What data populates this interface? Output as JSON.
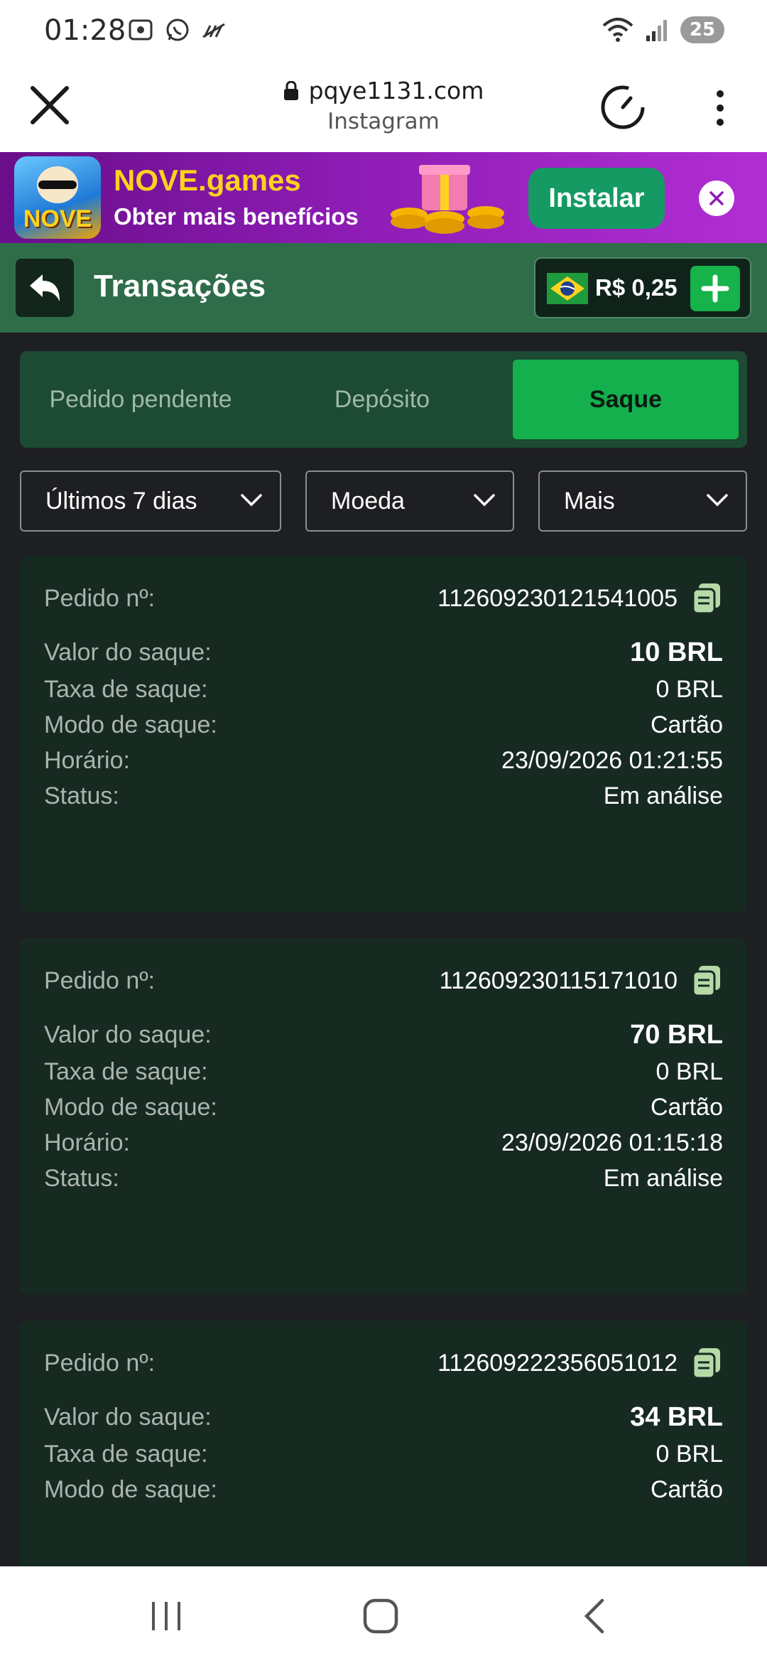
{
  "status_bar": {
    "time": "01:28",
    "battery": "25"
  },
  "browser": {
    "url": "pqye1131.com",
    "source": "Instagram"
  },
  "promo": {
    "brand": "NOVE.games",
    "subtitle": "Obter mais benefícios",
    "install_label": "Instalar",
    "logo_text": "NOVE"
  },
  "header": {
    "title": "Transações",
    "balance": "R$ 0,25"
  },
  "tabs": [
    {
      "label": "Pedido pendente",
      "active": false
    },
    {
      "label": "Depósito",
      "active": false
    },
    {
      "label": "Saque",
      "active": true
    }
  ],
  "filters": {
    "period": "Últimos 7 dias",
    "currency": "Moeda",
    "more": "Mais"
  },
  "labels": {
    "order": "Pedido nº:",
    "amount": "Valor do saque:",
    "fee": "Taxa de saque:",
    "mode": "Modo de saque:",
    "time": "Horário:",
    "status": "Status:"
  },
  "transactions": [
    {
      "order": "112609230121541005",
      "amount": "10 BRL",
      "fee": "0 BRL",
      "mode": "Cartão",
      "time": "23/09/2026 01:21:55",
      "status": "Em análise"
    },
    {
      "order": "112609230115171010",
      "amount": "70 BRL",
      "fee": "0 BRL",
      "mode": "Cartão",
      "time": "23/09/2026 01:15:18",
      "status": "Em análise"
    },
    {
      "order": "112609222356051012",
      "amount": "34 BRL",
      "fee": "0 BRL",
      "mode": "Cartão"
    }
  ],
  "colors": {
    "accent_green": "#14b04e",
    "header_green": "#2f6d4a",
    "card_bg": "#172a22",
    "promo_purple": "#8d1cb4",
    "brand_yellow": "#ffd21f"
  }
}
